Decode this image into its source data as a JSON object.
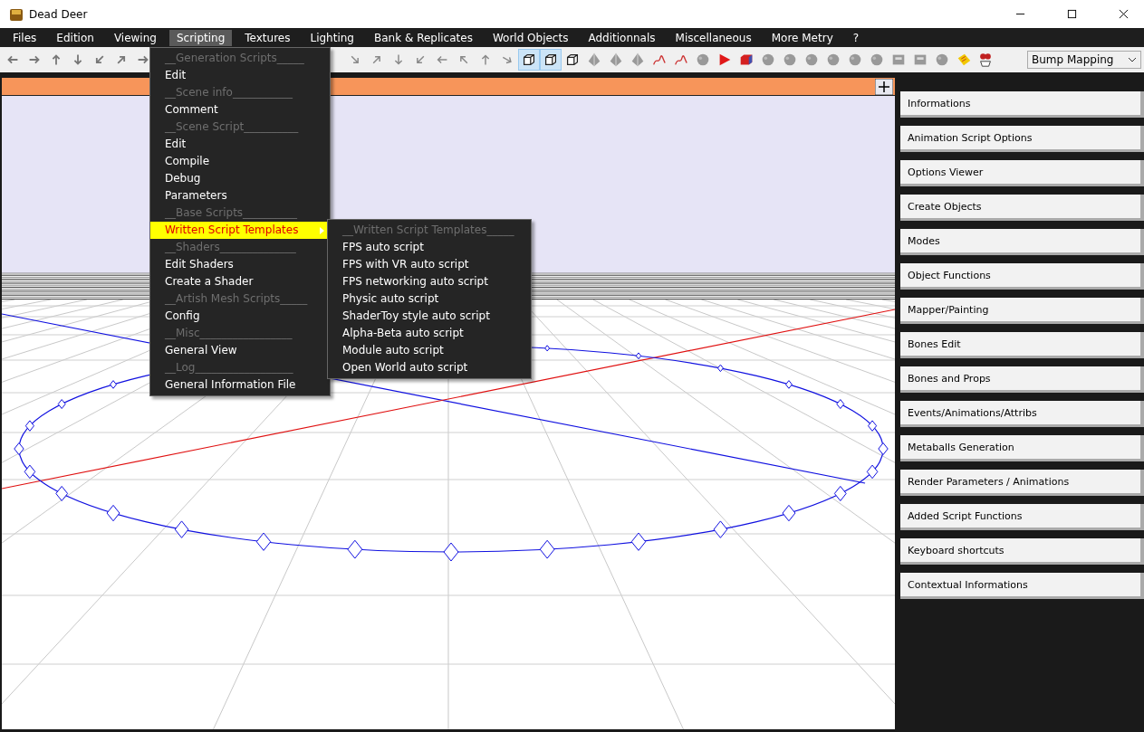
{
  "window": {
    "title": "Dead Deer"
  },
  "menu_bar": [
    {
      "label": "Files",
      "selected": false
    },
    {
      "label": "Edition",
      "selected": false
    },
    {
      "label": "Viewing",
      "selected": false
    },
    {
      "label": "Scripting",
      "selected": true
    },
    {
      "label": "Textures",
      "selected": false
    },
    {
      "label": "Lighting",
      "selected": false
    },
    {
      "label": "Bank & Replicates",
      "selected": false
    },
    {
      "label": "World Objects",
      "selected": false
    },
    {
      "label": "Additionnals",
      "selected": false
    },
    {
      "label": "Miscellaneous",
      "selected": false
    },
    {
      "label": "More Metry",
      "selected": false
    },
    {
      "label": "?",
      "selected": false
    }
  ],
  "toolbar": {
    "left_buttons": [
      {
        "selected": false
      },
      {
        "selected": false
      },
      {
        "selected": false
      },
      {
        "selected": false
      },
      {
        "selected": false
      },
      {
        "selected": false
      },
      {
        "selected": false
      }
    ],
    "right_buttons": [
      {
        "selected": false
      },
      {
        "selected": false
      },
      {
        "selected": false
      },
      {
        "selected": false
      },
      {
        "selected": false
      },
      {
        "selected": false
      },
      {
        "selected": false
      },
      {
        "selected": false
      },
      {
        "selected": true
      },
      {
        "selected": true
      },
      {
        "selected": false
      },
      {
        "selected": false
      },
      {
        "selected": false
      },
      {
        "selected": false
      },
      {
        "selected": false
      },
      {
        "selected": false
      },
      {
        "selected": false
      },
      {
        "selected": false
      },
      {
        "selected": false
      },
      {
        "selected": false
      },
      {
        "selected": false
      },
      {
        "selected": false
      },
      {
        "selected": false
      },
      {
        "selected": false
      },
      {
        "selected": false
      },
      {
        "selected": false
      },
      {
        "selected": false
      },
      {
        "selected": false
      },
      {
        "selected": false
      },
      {
        "selected": false
      }
    ],
    "render_mode": "Bump Mapping"
  },
  "scripting_menu": {
    "items": [
      {
        "label": "__Generation Scripts_____",
        "kind": "header",
        "selected": false
      },
      {
        "label": "Edit",
        "kind": "item",
        "selected": false
      },
      {
        "label": "__Scene info___________",
        "kind": "header",
        "selected": false
      },
      {
        "label": "Comment",
        "kind": "item",
        "selected": false
      },
      {
        "label": "__Scene Script__________",
        "kind": "header",
        "selected": false
      },
      {
        "label": "Edit",
        "kind": "item",
        "selected": false
      },
      {
        "label": "Compile",
        "kind": "item",
        "selected": false
      },
      {
        "label": "Debug",
        "kind": "item",
        "selected": false
      },
      {
        "label": "Parameters",
        "kind": "item",
        "selected": false
      },
      {
        "label": "__Base Scripts__________",
        "kind": "header",
        "selected": false
      },
      {
        "label": "Written Script Templates",
        "kind": "submenu",
        "selected": true
      },
      {
        "label": "__Shaders______________",
        "kind": "header",
        "selected": false
      },
      {
        "label": "Edit Shaders",
        "kind": "item",
        "selected": false
      },
      {
        "label": "Create a Shader",
        "kind": "item",
        "selected": false
      },
      {
        "label": "__Artish Mesh Scripts_____",
        "kind": "header",
        "selected": false
      },
      {
        "label": "Config",
        "kind": "item",
        "selected": false
      },
      {
        "label": "__Misc_________________",
        "kind": "header",
        "selected": false
      },
      {
        "label": "General View",
        "kind": "item",
        "selected": false
      },
      {
        "label": "__Log__________________",
        "kind": "header",
        "selected": false
      },
      {
        "label": "General Information File",
        "kind": "item",
        "selected": false
      }
    ]
  },
  "templates_submenu": {
    "items": [
      {
        "label": "__Written Script Templates_____",
        "kind": "header",
        "selected": false
      },
      {
        "label": "FPS auto script",
        "kind": "item",
        "selected": false
      },
      {
        "label": "FPS with VR auto script",
        "kind": "item",
        "selected": false
      },
      {
        "label": "FPS networking auto script",
        "kind": "item",
        "selected": false
      },
      {
        "label": "Physic auto script",
        "kind": "item",
        "selected": false
      },
      {
        "label": "ShaderToy style auto script",
        "kind": "item",
        "selected": false
      },
      {
        "label": "Alpha-Beta auto script",
        "kind": "item",
        "selected": false
      },
      {
        "label": "Module auto script",
        "kind": "item",
        "selected": false
      },
      {
        "label": "Open World auto script",
        "kind": "item",
        "selected": false
      }
    ]
  },
  "side_panel": {
    "buttons": [
      "Informations",
      "Animation Script Options",
      "Options Viewer",
      "Create Objects",
      "Modes",
      "Object Functions",
      "Mapper/Painting",
      "Bones Edit",
      "Bones and Props",
      "Events/Animations/Attribs",
      "Metaballs Generation",
      "Render Parameters / Animations",
      "Added Script Functions",
      "Keyboard shortcuts",
      "Contextual Informations"
    ]
  }
}
